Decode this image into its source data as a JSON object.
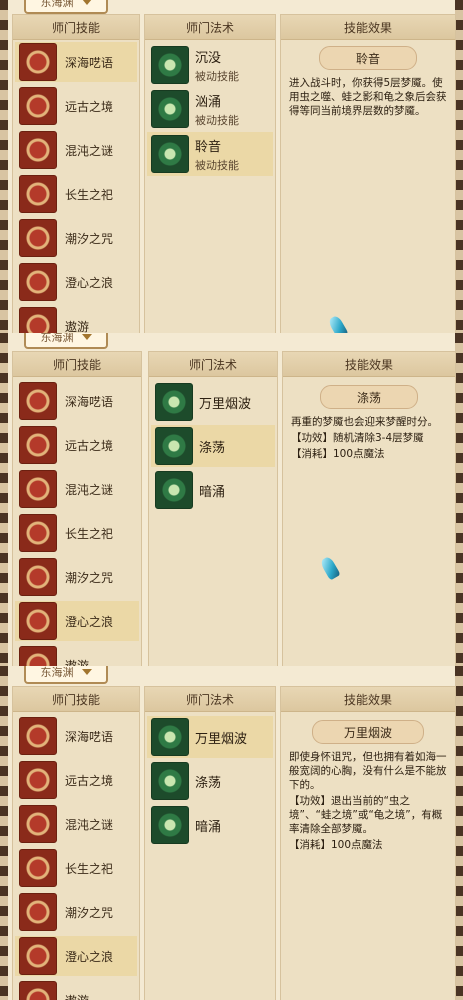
{
  "headers": {
    "school_skills": "师门技能",
    "school_spells": "师门法术",
    "skill_effect": "技能效果"
  },
  "dropdown": {
    "value": "东海渊"
  },
  "panels": [
    {
      "skills": [
        "深海呓语",
        "远古之境",
        "混沌之谜",
        "长生之祀",
        "潮汐之咒",
        "澄心之浪",
        "遨游"
      ],
      "selected_skill": 0,
      "spells": [
        {
          "name": "沉没",
          "type": "被动技能"
        },
        {
          "name": "汹涌",
          "type": "被动技能"
        },
        {
          "name": "聆音",
          "type": "被动技能"
        }
      ],
      "selected_spell": 2,
      "effect": {
        "title": "聆音",
        "lines": [
          "进入战斗时，你获得5层梦魇。使用虫之噬、蛙之影和龟之象后会获得等同当前境界层数的梦魇。"
        ]
      }
    },
    {
      "skills": [
        "深海呓语",
        "远古之境",
        "混沌之谜",
        "长生之祀",
        "潮汐之咒",
        "澄心之浪",
        "遨游"
      ],
      "selected_skill": 5,
      "spells": [
        {
          "name": "万里烟波",
          "type": ""
        },
        {
          "name": "涤荡",
          "type": ""
        },
        {
          "name": "暗涌",
          "type": ""
        }
      ],
      "selected_spell": 1,
      "effect": {
        "title": "涤荡",
        "lines": [
          "再重的梦魇也会迎来梦醒时分。",
          "【功效】随机清除3-4层梦魇",
          "【消耗】100点魔法"
        ]
      }
    },
    {
      "skills": [
        "深海呓语",
        "远古之境",
        "混沌之谜",
        "长生之祀",
        "潮汐之咒",
        "澄心之浪",
        "遨游"
      ],
      "selected_skill": 5,
      "spells": [
        {
          "name": "万里烟波",
          "type": ""
        },
        {
          "name": "涤荡",
          "type": ""
        },
        {
          "name": "暗涌",
          "type": ""
        }
      ],
      "selected_spell": 0,
      "effect": {
        "title": "万里烟波",
        "lines": [
          "即使身怀诅咒，但也拥有着如海一般宽阔的心胸，没有什么是不能放下的。",
          "【功效】退出当前的“虫之境”、“蛙之境”或“龟之境”，有概率清除全部梦魇。",
          "【消耗】100点魔法"
        ]
      }
    }
  ],
  "icons": {
    "skill_icon": "red-rune-icon",
    "spell_icon": "green-rune-icon"
  }
}
